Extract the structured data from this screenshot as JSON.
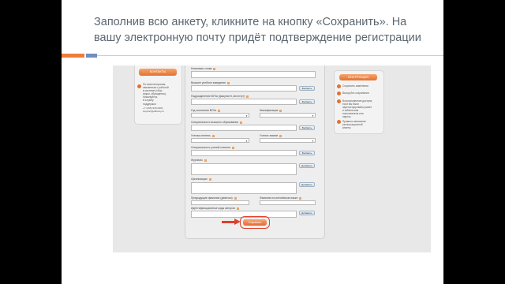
{
  "slide": {
    "title": "Заполнив всю анкету, кликните на кнопку «Сохранить». На вашу электронную почту придёт подтверждение регистрации",
    "colors": {
      "accent_orange": "#ef7b3a",
      "accent_blue": "#6f8fc0",
      "title_text": "#5c6670",
      "highlight_red": "#e0402a"
    }
  },
  "screenshot": {
    "left_panel": {
      "tab": "контакты",
      "text": "По всем вопросам,\nсвязанным с работой\nв системе (сбор\nформ, обращения),\nпожалуйста,\nв службу\nподдержки",
      "contacts": "+7 (495) 933-0681\nsupport@elibrary.ru"
    },
    "form": {
      "labels": {
        "keywords": "Ключевые слова",
        "university": "Высшее учебное заведение",
        "department": "Подразделение ВУЗа (факультет, институт)",
        "grad_year": "Год окончания ВУЗа",
        "qualification": "Квалификация",
        "specialty": "Специальность высшего образования",
        "degree": "Ученая степень",
        "title": "Ученое звание",
        "degree_specialty": "Специальность ученой степени",
        "journals": "Журналы",
        "organizations": "Организации",
        "prev_names": "Предыдущие фамилии (девичьи)",
        "english_name": "Фамилия на английском языке",
        "author_ids": "Идентификационные коды авторов"
      },
      "select_label": "Выбрать",
      "add_label": "Добавить",
      "save_label": "Сохранить"
    },
    "right_panel": {
      "tab": "инструкция",
      "items": [
        "Сохранить изменения",
        "Выход без сохранения",
        "Восстановление доступа,\nесли Вы были\nзарегистрированы ранее\nи забыли имя\nпользователя или\nпароль",
        "Правила написания\nрегистрационной\nанкеты"
      ]
    }
  }
}
